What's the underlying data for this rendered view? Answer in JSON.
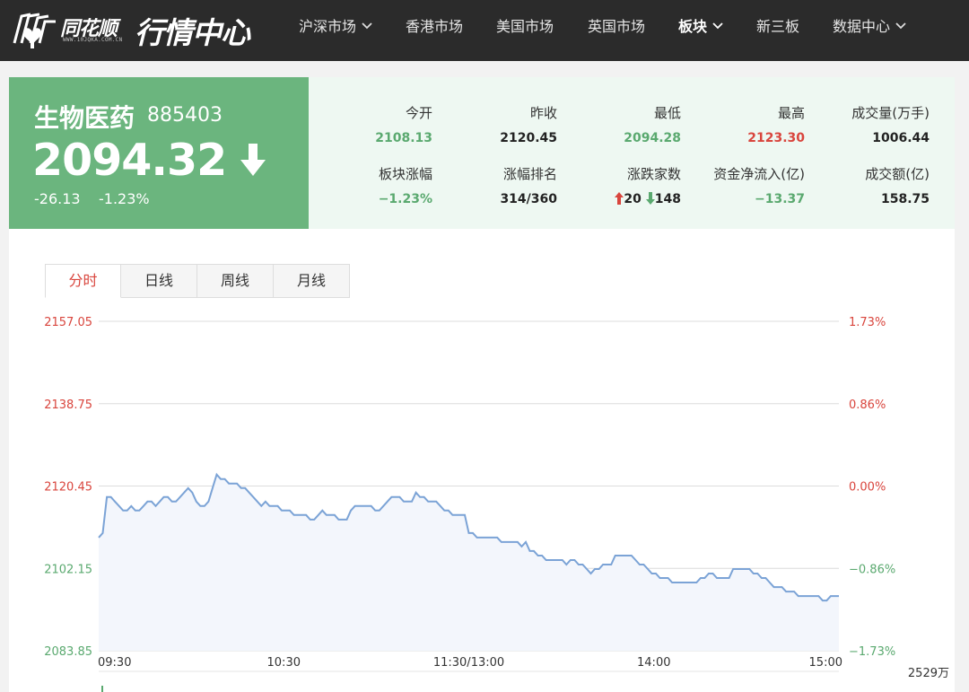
{
  "brand": {
    "logo_text": "同花顺",
    "logo_url": "WWW.10JQKA.COM.CN",
    "title": "行情中心"
  },
  "nav": {
    "items": [
      {
        "label": "沪深市场",
        "dropdown": true
      },
      {
        "label": "香港市场",
        "dropdown": false
      },
      {
        "label": "美国市场",
        "dropdown": false
      },
      {
        "label": "英国市场",
        "dropdown": false
      },
      {
        "label": "板块",
        "dropdown": true,
        "active": true
      },
      {
        "label": "新三板",
        "dropdown": false
      },
      {
        "label": "数据中心",
        "dropdown": true
      }
    ]
  },
  "quote": {
    "name": "生物医药",
    "code": "885403",
    "price": "2094.32",
    "change": "-26.13",
    "change_pct": "-1.23%",
    "direction": "down"
  },
  "stats": [
    {
      "label": "今开",
      "value": "2108.13",
      "color": "green"
    },
    {
      "label": "昨收",
      "value": "2120.45",
      "color": "dark"
    },
    {
      "label": "最低",
      "value": "2094.28",
      "color": "green"
    },
    {
      "label": "最高",
      "value": "2123.30",
      "color": "red"
    },
    {
      "label": "成交量(万手)",
      "value": "1006.44",
      "color": "dark"
    },
    {
      "label": "板块涨幅",
      "value": "−1.23%",
      "color": "green"
    },
    {
      "label": "涨幅排名",
      "value": "314/360",
      "color": "dark"
    },
    {
      "label": "涨跌家数",
      "up": "20",
      "down": "148",
      "color": "dark"
    },
    {
      "label": "资金净流入(亿)",
      "value": "−13.37",
      "color": "green"
    },
    {
      "label": "成交额(亿)",
      "value": "158.75",
      "color": "dark"
    }
  ],
  "tabs": [
    {
      "label": "分时",
      "active": true
    },
    {
      "label": "日线",
      "active": false
    },
    {
      "label": "周线",
      "active": false
    },
    {
      "label": "月线",
      "active": false
    }
  ],
  "colors": {
    "up": "#d9453d",
    "down": "#5aa96f",
    "line": "#7ba3d6",
    "area": "#f3f6fc"
  },
  "chart_data": {
    "type": "area",
    "y_left_ticks": [
      "2157.05",
      "2138.75",
      "2120.45",
      "2102.15",
      "2083.85"
    ],
    "y_right_ticks": [
      "1.73%",
      "0.86%",
      "0.00%",
      "−0.86%",
      "−1.73%"
    ],
    "ylim": [
      2083.85,
      2157.05
    ],
    "x_ticks": [
      "09:30",
      "10:30",
      "11:30/13:00",
      "14:00",
      "15:00"
    ],
    "volume_label": "2529万",
    "series": [
      {
        "values": [
          2109,
          2110,
          2118,
          2118,
          2117,
          2116,
          2115,
          2115,
          2116,
          2115,
          2115,
          2116,
          2117,
          2117,
          2116,
          2117,
          2118,
          2118,
          2117,
          2117,
          2118,
          2119,
          2120,
          2119,
          2117,
          2116,
          2116,
          2117,
          2120,
          2123,
          2122,
          2122,
          2121,
          2121,
          2121,
          2120,
          2120,
          2119,
          2118,
          2117,
          2116,
          2117,
          2116,
          2116,
          2116,
          2115,
          2115,
          2115,
          2114,
          2114,
          2114,
          2114,
          2113,
          2113,
          2114,
          2115,
          2114,
          2114,
          2114,
          2113,
          2113,
          2113,
          2115,
          2116,
          2116,
          2116,
          2116,
          2116,
          2115,
          2115,
          2116,
          2117,
          2118,
          2118,
          2118,
          2117,
          2117,
          2117,
          2119,
          2118,
          2118,
          2117,
          2117,
          2117,
          2116,
          2115,
          2115,
          2114,
          2114,
          2114,
          2114,
          2110,
          2110,
          2109,
          2109,
          2109,
          2109,
          2109,
          2109,
          2108,
          2108,
          2108,
          2108,
          2108,
          2107,
          2108,
          2106,
          2106,
          2105,
          2105,
          2104,
          2104,
          2104,
          2104,
          2104,
          2103,
          2104,
          2104,
          2103,
          2103,
          2102,
          2101,
          2102,
          2102,
          2103,
          2103,
          2103,
          2105,
          2105,
          2105,
          2105,
          2105,
          2104,
          2103,
          2103,
          2102,
          2101,
          2101,
          2100,
          2100,
          2100,
          2099,
          2099,
          2099,
          2099,
          2099,
          2099,
          2099,
          2100,
          2100,
          2101,
          2101,
          2100,
          2100,
          2100,
          2100,
          2102,
          2102,
          2102,
          2102,
          2102,
          2101,
          2101,
          2100,
          2100,
          2099,
          2098,
          2098,
          2098,
          2097,
          2097,
          2097,
          2096,
          2096,
          2096,
          2096,
          2096,
          2096,
          2095,
          2095,
          2096,
          2096,
          2096
        ]
      }
    ]
  }
}
